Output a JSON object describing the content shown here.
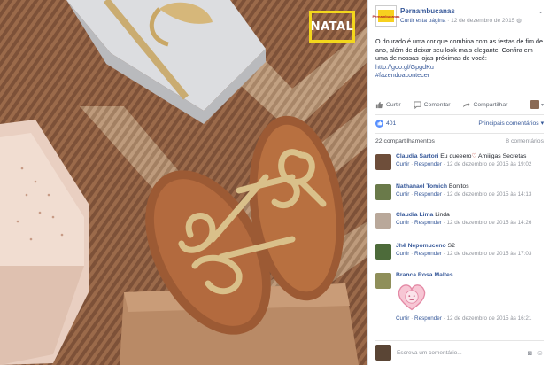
{
  "photo": {
    "badge_text": "NATAL"
  },
  "post": {
    "page_name": "Pernambucanas",
    "meta_like": "Curtir esta página",
    "meta_sep": " · ",
    "meta_date": "12 de dezembro de 2015",
    "text_plain": "O dourado é uma cor que combina com as festas de fim de ano, além de deixar seu look mais elegante. Confira em uma de nossas lojas próximas de você: ",
    "link": "http://goo.gl/GpgdKu",
    "hashtag": "#fazendoacontecer",
    "logo_text": "Pernambucanas"
  },
  "actions": {
    "like": "Curtir",
    "comment": "Comentar",
    "share": "Compartilhar"
  },
  "reactions": {
    "count": "401",
    "top_comments": "Principais comentários ▾"
  },
  "stats": {
    "shares": "22 compartilhamentos",
    "comments": "8 comentários"
  },
  "comments": [
    {
      "author": "Claudia Sartori",
      "text": " Eu queeero",
      "heart": "♡",
      "tail": " Amiiigas Secretas",
      "like": "Curtir",
      "reply": "Responder",
      "date": "12 de dezembro de 2015 às 19:02",
      "avatar_color": "#6e4e3a"
    },
    {
      "author": "Nathanael Tomich",
      "text": " Bonitos",
      "like": "Curtir",
      "reply": "Responder",
      "date": "12 de dezembro de 2015 às 14:13",
      "avatar_color": "#6a7a4a"
    },
    {
      "author": "Claudia Lima",
      "text": " Linda",
      "like": "Curtir",
      "reply": "Responder",
      "date": "12 de dezembro de 2015 às 14:26",
      "avatar_color": "#b9a89a"
    },
    {
      "author": "Jhê Nepomuceno",
      "text": " S2",
      "like": "Curtir",
      "reply": "Responder",
      "date": "12 de dezembro de 2015 às 17:03",
      "avatar_color": "#4d6b3a"
    },
    {
      "author": "Branca Rosa Maltes",
      "text": "",
      "like": "Curtir",
      "reply": "Responder",
      "date": "12 de dezembro de 2015 às 16:21",
      "avatar_color": "#8f8f5a"
    }
  ],
  "composer": {
    "placeholder": "Escreva um comentário..."
  },
  "colors": {
    "link_blue": "#365899",
    "meta_gray": "#90949c",
    "badge_yellow": "#f3d71c",
    "like_blue": "#5890ff"
  }
}
